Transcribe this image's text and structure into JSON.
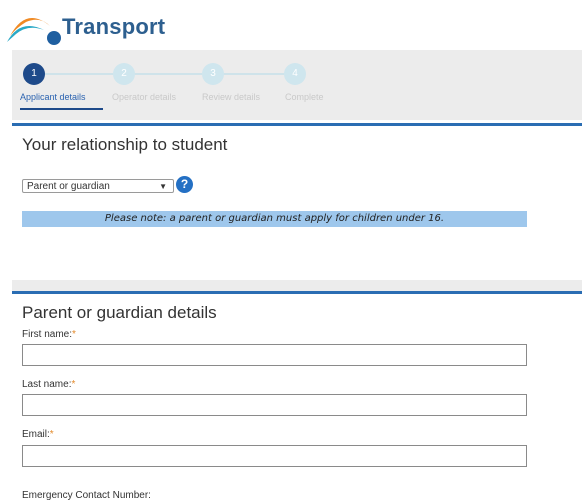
{
  "brand": {
    "name": "Transport"
  },
  "progress": {
    "steps": [
      {
        "number": "1",
        "label": "Applicant details"
      },
      {
        "number": "2",
        "label": "Operator details"
      },
      {
        "number": "3",
        "label": "Review details"
      },
      {
        "number": "4",
        "label": "Complete"
      }
    ],
    "active_step": 1
  },
  "relationship": {
    "title": "Your relationship to student",
    "select_value": "Parent or guardian",
    "help_icon": "?",
    "note": "Please note: a parent or guardian must apply for children under 16."
  },
  "guardian": {
    "title": "Parent or guardian details",
    "required_mark": "*",
    "fields": [
      {
        "label": "First name:",
        "required": true,
        "value": ""
      },
      {
        "label": "Last name:",
        "required": true,
        "value": ""
      },
      {
        "label": "Email:",
        "required": true,
        "value": ""
      }
    ],
    "emergency_label": "Emergency Contact Number:"
  },
  "colors": {
    "accent": "#2a6db3",
    "active_step": "#1e4a8a",
    "inactive_step": "#cfe6ee",
    "note_bg": "#9ec7ec",
    "required": "#e38a2b"
  }
}
